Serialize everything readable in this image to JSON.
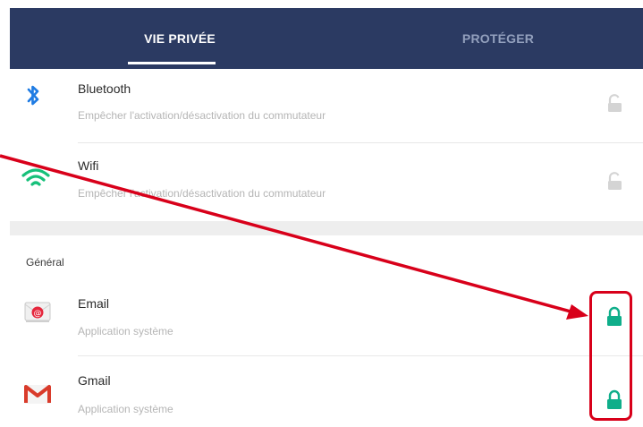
{
  "tabs": [
    {
      "label": "VIE PRIVÉE",
      "active": true
    },
    {
      "label": "PROTÉGER",
      "active": false
    }
  ],
  "rows": [
    {
      "title": "Bluetooth",
      "subtitle": "Empêcher l'activation/désactivation du commutateur",
      "icon": "bluetooth-icon",
      "locked": false
    },
    {
      "title": "Wifi",
      "subtitle": "Empêcher l'activation/désactivation du commutateur",
      "icon": "wifi-icon",
      "locked": false
    }
  ],
  "section": {
    "label": "Général"
  },
  "apps": [
    {
      "title": "Email",
      "subtitle": "Application système",
      "icon": "email-icon",
      "locked": true
    },
    {
      "title": "Gmail",
      "subtitle": "Application système",
      "icon": "gmail-icon",
      "locked": true
    }
  ],
  "colors": {
    "header_bg": "#2b3a62",
    "lock_active": "#0fae8a",
    "lock_inactive": "#d4d4d4",
    "annotation": "#d8001a"
  }
}
